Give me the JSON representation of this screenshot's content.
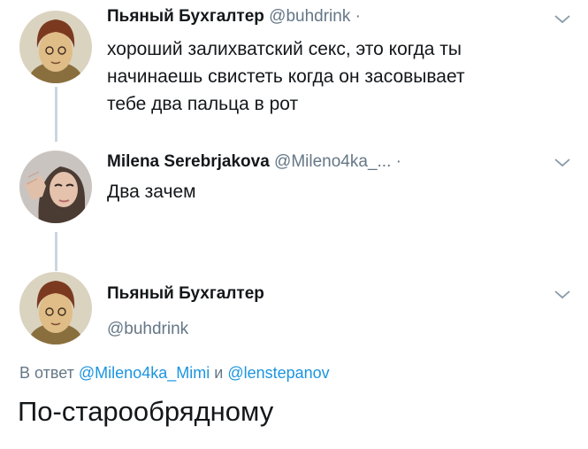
{
  "tweet1": {
    "name": "Пьяный Бухгалтер",
    "handle": "@buhdrink",
    "separator": "·",
    "lines": [
      "хороший залихватский секс, это когда ты",
      "начинаешь свистеть когда он засовывает",
      "тебе два пальца в рот"
    ]
  },
  "tweet2": {
    "name": "Milena Serebrjakova",
    "handle": "@Mileno4ka_...",
    "separator": "·",
    "text": "Два зачем"
  },
  "tweet3": {
    "name": "Пьяный Бухгалтер",
    "handle": "@buhdrink",
    "reply_prefix": "В ответ",
    "reply_mention1": "@Mileno4ka_Mimi",
    "reply_and": "и",
    "reply_mention2": "@lenstepanov",
    "text": "По-старообрядному"
  },
  "icons": {
    "avatar1": "cartoon-avatar-icon",
    "avatar2": "user-photo-avatar",
    "avatar3": "cartoon-avatar-icon",
    "menu": "chevron-down-icon"
  },
  "colors": {
    "text": "#14171a",
    "muted": "#657786",
    "link": "#1b95e0",
    "thread_line": "#ccd6dd"
  }
}
